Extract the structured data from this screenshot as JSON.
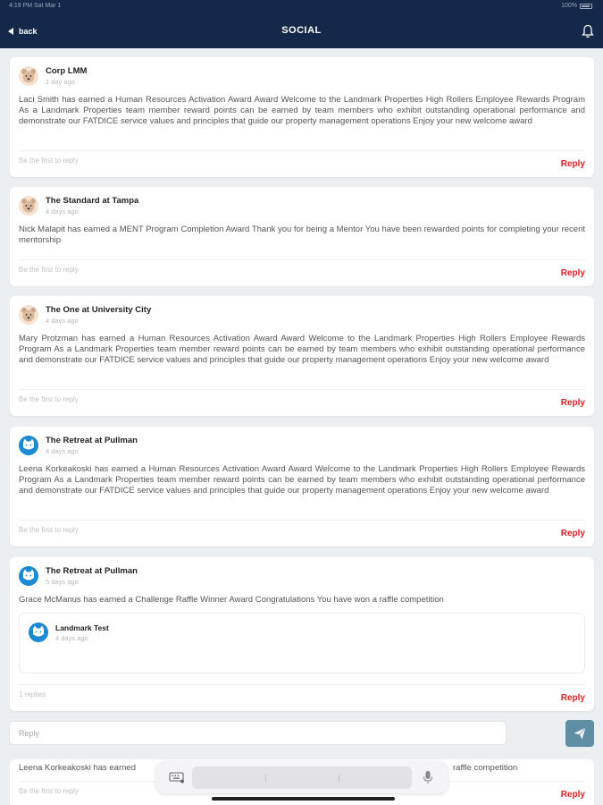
{
  "status": {
    "time": "4:19 PM   Sat Mar 1",
    "battery": "100%"
  },
  "header": {
    "back_label": "back",
    "title": "SOCIAL"
  },
  "posts": [
    {
      "author": "Corp LMM",
      "ago": "1 day ago",
      "text": "Laci Smith has earned a Human Resources Activation Award Award Welcome to the Landmark Properties High Rollers Employee Rewards Program As a Landmark Properties team member reward points can be earned by team members who exhibit outstanding operational performance and demonstrate our FATDICE service values and principles that guide our property management operations Enjoy your new welcome award",
      "replies_info": "Be the first to reply",
      "reply_label": "Reply",
      "avatar": "bear-icon"
    },
    {
      "author": "The Standard at Tampa",
      "ago": "4 days ago",
      "text": "Nick Malapit has earned a MENT Program Completion Award Thank you for being a Mentor You have been rewarded points for completing your recent mentorship",
      "replies_info": "Be the first to reply",
      "reply_label": "Reply",
      "avatar": "bear-icon"
    },
    {
      "author": "The One at University City",
      "ago": "4 days ago",
      "text": "Mary Protzman has earned a Human Resources Activation Award Award Welcome to the Landmark Properties High Rollers Employee Rewards Program As a Landmark Properties team member reward points can be earned by team members who exhibit outstanding operational performance and demonstrate our FATDICE service values and principles that guide our property management operations Enjoy your new welcome award",
      "replies_info": "Be the first to reply",
      "reply_label": "Reply",
      "avatar": "bear-icon"
    },
    {
      "author": "The Retreat at Pullman",
      "ago": "4 days ago",
      "text": "Leena Korkeakoski has earned a Human Resources Activation Award Award Welcome to the Landmark Properties High Rollers Employee Rewards Program As a Landmark Properties team member reward points can be earned by team members who exhibit outstanding operational performance and demonstrate our FATDICE service values and principles that guide our property management operations Enjoy your new welcome award",
      "replies_info": "Be the first to reply",
      "reply_label": "Reply",
      "avatar": "cat-icon"
    },
    {
      "author": "The Retreat at Pullman",
      "ago": "5 days ago",
      "text": "Grace McManus has earned a Challenge Raffle Winner Award Congratulations You have won a raffle competition",
      "replies_info": "1 replies",
      "reply_label": "Reply",
      "avatar": "cat-icon",
      "nested_reply": {
        "author": "Landmark Test",
        "ago": "4 days ago",
        "avatar": "cat-icon"
      }
    },
    {
      "text_start": "Leena Korkeakoski has earned",
      "text_end": "raffle competition",
      "replies_info": "Be the first to reply",
      "reply_label": "Reply"
    }
  ],
  "reply_bar": {
    "placeholder": "Reply",
    "send_icon": "paper-plane-icon"
  },
  "keyboard_bar": {
    "left_icon": "keyboard-icon",
    "right_icon": "microphone-icon"
  },
  "colors": {
    "header_bg": "#14294a",
    "reply_red": "#e0201f",
    "send_bg": "#5e8ea4",
    "page_bg": "#eceff1"
  }
}
